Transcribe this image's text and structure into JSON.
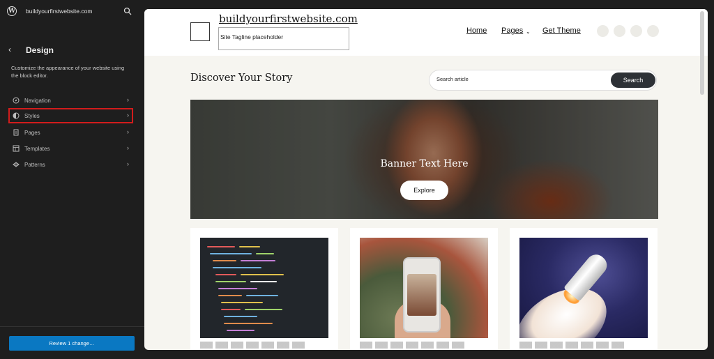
{
  "sidebar": {
    "site_name": "buildyourfirstwebsite.com",
    "title": "Design",
    "description": "Customize the appearance of your website using the block editor.",
    "items": [
      {
        "label": "Navigation",
        "icon": "compass-icon"
      },
      {
        "label": "Styles",
        "icon": "half-circle-icon",
        "highlighted": true
      },
      {
        "label": "Pages",
        "icon": "page-icon"
      },
      {
        "label": "Templates",
        "icon": "layout-icon"
      },
      {
        "label": "Patterns",
        "icon": "diamond-icon"
      }
    ],
    "review_button": "Review 1 change…"
  },
  "preview": {
    "site_title": "buildyourfirstwebsite.com",
    "tagline": "Site Tagline placeholder",
    "nav": [
      {
        "label": "Home"
      },
      {
        "label": "Pages",
        "has_dropdown": true
      },
      {
        "label": "Get Theme"
      }
    ],
    "social_icons": [
      "facebook-icon",
      "twitter-icon",
      "instagram-icon",
      "youtube-icon"
    ],
    "heading": "Discover Your Story",
    "search": {
      "placeholder": "Search article",
      "button": "Search"
    },
    "banner": {
      "text": "Banner Text Here",
      "button": "Explore"
    },
    "cards": [
      {
        "image": "code-on-screen"
      },
      {
        "image": "phone-in-hand"
      },
      {
        "image": "rocket-launch"
      }
    ]
  },
  "colors": {
    "highlight": "#d21c1c",
    "review_button": "#0a78c2",
    "search_button": "#2d3136",
    "preview_background": "#f6f5f0"
  }
}
